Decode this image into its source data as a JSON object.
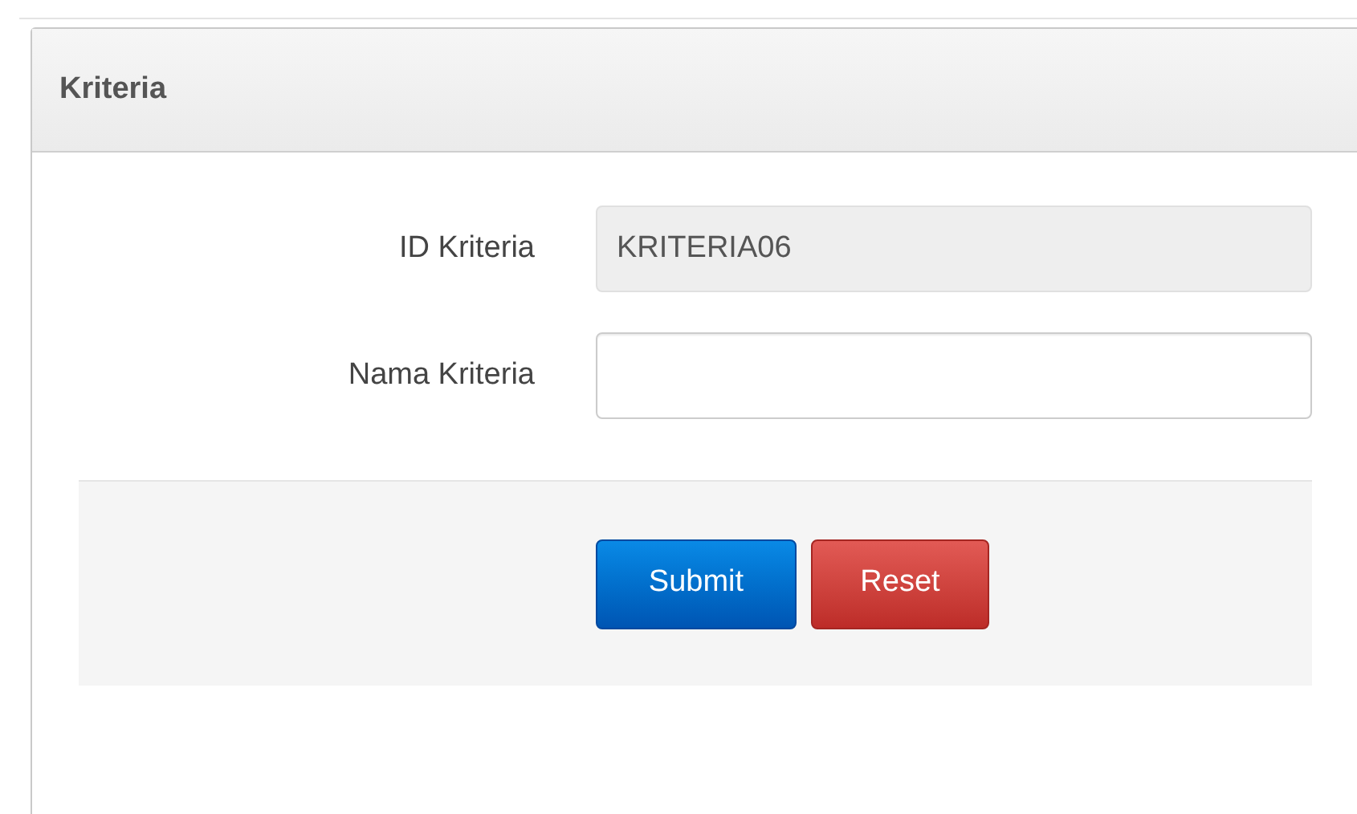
{
  "panel": {
    "title": "Kriteria"
  },
  "fields": [
    {
      "label": "ID Kriteria",
      "value": "KRITERIA06",
      "readonly": true
    },
    {
      "label": "Nama Kriteria",
      "readonly": false
    }
  ],
  "buttons": [
    {
      "label": "Submit",
      "kind": "primary"
    },
    {
      "label": "Reset",
      "kind": "danger"
    }
  ]
}
